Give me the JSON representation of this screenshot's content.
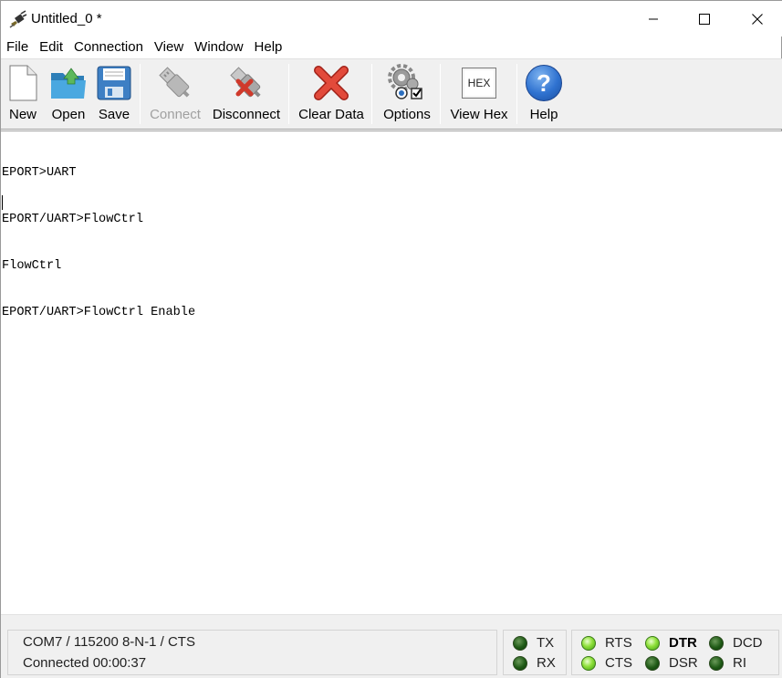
{
  "window": {
    "title": "Untitled_0 *"
  },
  "menu": [
    "File",
    "Edit",
    "Connection",
    "View",
    "Window",
    "Help"
  ],
  "toolbar": {
    "new": "New",
    "open": "Open",
    "save": "Save",
    "connect": "Connect",
    "disconnect": "Disconnect",
    "clear_data": "Clear Data",
    "options": "Options",
    "view_hex": "View Hex",
    "hex_icon_text": "HEX",
    "help": "Help",
    "help_icon_text": "?"
  },
  "terminal": {
    "lines": [
      "EPORT>UART",
      "EPORT/UART>FlowCtrl",
      "FlowCtrl",
      "EPORT/UART>FlowCtrl Enable"
    ]
  },
  "status": {
    "port_settings": "COM7 / 115200 8-N-1 / CTS",
    "connection": "Connected 00:00:37",
    "tx": "TX",
    "rx": "RX",
    "rts": "RTS",
    "cts": "CTS",
    "dtr": "DTR",
    "dsr": "DSR",
    "dcd": "DCD",
    "ri": "RI"
  },
  "leds": {
    "tx": "off",
    "rx": "off",
    "rts": "on",
    "cts": "on",
    "dtr": "on",
    "dsr": "off",
    "dcd": "off",
    "ri": "off"
  },
  "colors": {
    "led_on": "#8fe03a",
    "led_off": "#1f5a16",
    "toolbar_bg": "#f0f0f0"
  }
}
